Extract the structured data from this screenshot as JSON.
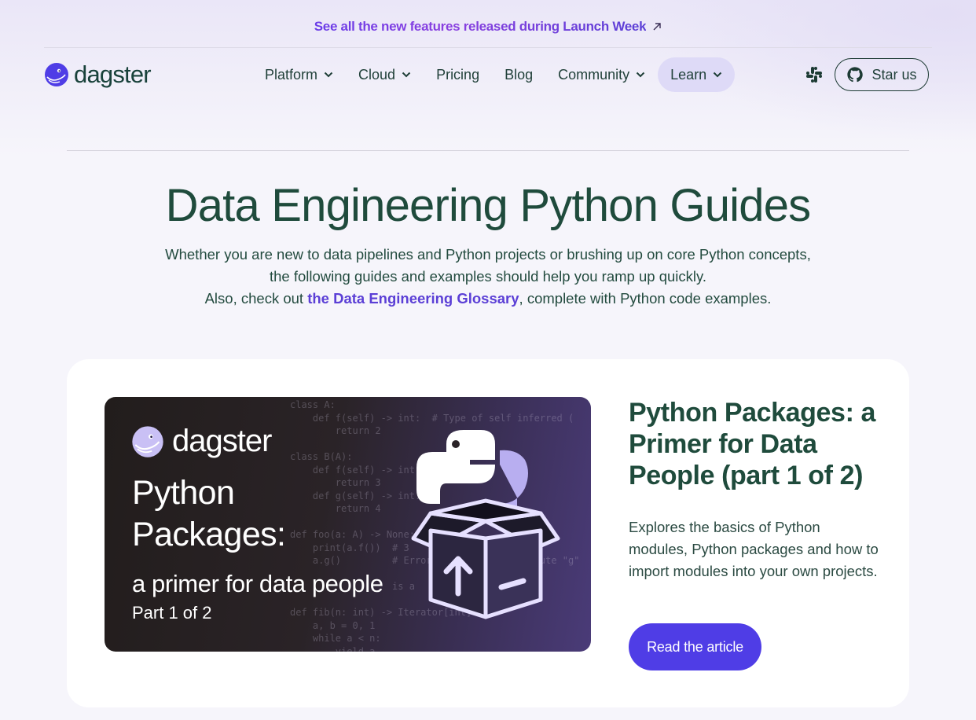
{
  "announcement": {
    "text": "See all the new features released during Launch Week"
  },
  "brand": {
    "name": "dagster"
  },
  "nav": {
    "items": [
      {
        "label": "Platform",
        "has_dropdown": true,
        "active": false
      },
      {
        "label": "Cloud",
        "has_dropdown": true,
        "active": false
      },
      {
        "label": "Pricing",
        "has_dropdown": false,
        "active": false
      },
      {
        "label": "Blog",
        "has_dropdown": false,
        "active": false
      },
      {
        "label": "Community",
        "has_dropdown": true,
        "active": false
      },
      {
        "label": "Learn",
        "has_dropdown": true,
        "active": true
      }
    ],
    "star_label": "Star us",
    "icons": [
      "slack-icon",
      "github-icon"
    ]
  },
  "hero": {
    "title": "Data Engineering Python Guides",
    "line1": "Whether you are new to data pipelines and Python projects or brushing up on core Python concepts,",
    "line2": "the following guides and examples should help you ramp up quickly.",
    "line3_prefix": "Also, check out ",
    "line3_link": "the Data Engineering Glossary",
    "line3_suffix": ", complete with Python code examples."
  },
  "article": {
    "image": {
      "brand": "dagster",
      "title_line1": "Python",
      "title_line2": "Packages:",
      "tagline": "a primer for data people",
      "part": "Part 1 of 2",
      "code_lines": [
        "class A:",
        "    def f(self) -> int:  # Type of self inferred (",
        "        return 2",
        "",
        "class B(A):",
        "    def f(self) -> int:",
        "        return 3",
        "    def g(self) -> int:",
        "        return 4",
        "",
        "def foo(a: A) -> None:",
        "    print(a.f())  # 3",
        "    a.g()         # Error: \"A\" has no attribute \"g\"",
        "",
        "                  is a",
        "",
        "def fib(n: int) -> Iterator[int]:",
        "    a, b = 0, 1",
        "    while a < n:",
        "        yield a"
      ]
    },
    "title": "Python Packages: a Primer for Data People (part 1 of 2)",
    "description": "Explores the basics of Python modules, Python packages and how to import modules into your own projects.",
    "cta": "Read the article"
  },
  "colors": {
    "accent": "#4f3de6",
    "link": "#5b3fd6",
    "heading": "#1f4b3c",
    "active_nav_bg": "#dedaf7"
  }
}
